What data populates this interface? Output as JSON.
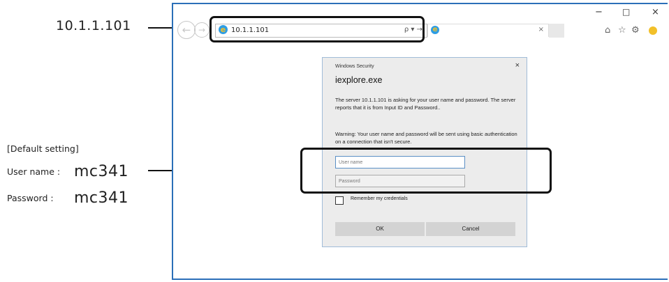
{
  "annotations": {
    "ip": "10.1.1.101",
    "default_setting": "[Default setting]",
    "user_label": "User name :",
    "user_value": "mc341",
    "pass_label": "Password :",
    "pass_value": "mc341"
  },
  "browser": {
    "address_url": "10.1.1.101",
    "address_tools": "ρ ▾ →",
    "tab_close": "×",
    "window_controls": {
      "minimize": "−",
      "maximize": "□",
      "close": "×"
    },
    "icons": {
      "back": "back-arrow-icon",
      "forward": "forward-arrow-icon",
      "ie": "internet-explorer-icon",
      "home": "home-icon",
      "favorites": "star-icon",
      "settings": "gear-icon",
      "feedback": "smiley-icon"
    },
    "frame_color": "#2b6fb8"
  },
  "dialog": {
    "window_title": "Windows Security",
    "close": "×",
    "app_name": "iexplore.exe",
    "message": "The server 10.1.1.101 is asking for your user name and password. The server reports that it is from Input ID and Password..",
    "warning": "Warning: Your user name and password will be sent using basic authentication on a connection that isn't secure.",
    "username_placeholder": "User name",
    "password_placeholder": "Password",
    "remember_label": "Remember my credentials",
    "ok_label": "OK",
    "cancel_label": "Cancel"
  }
}
